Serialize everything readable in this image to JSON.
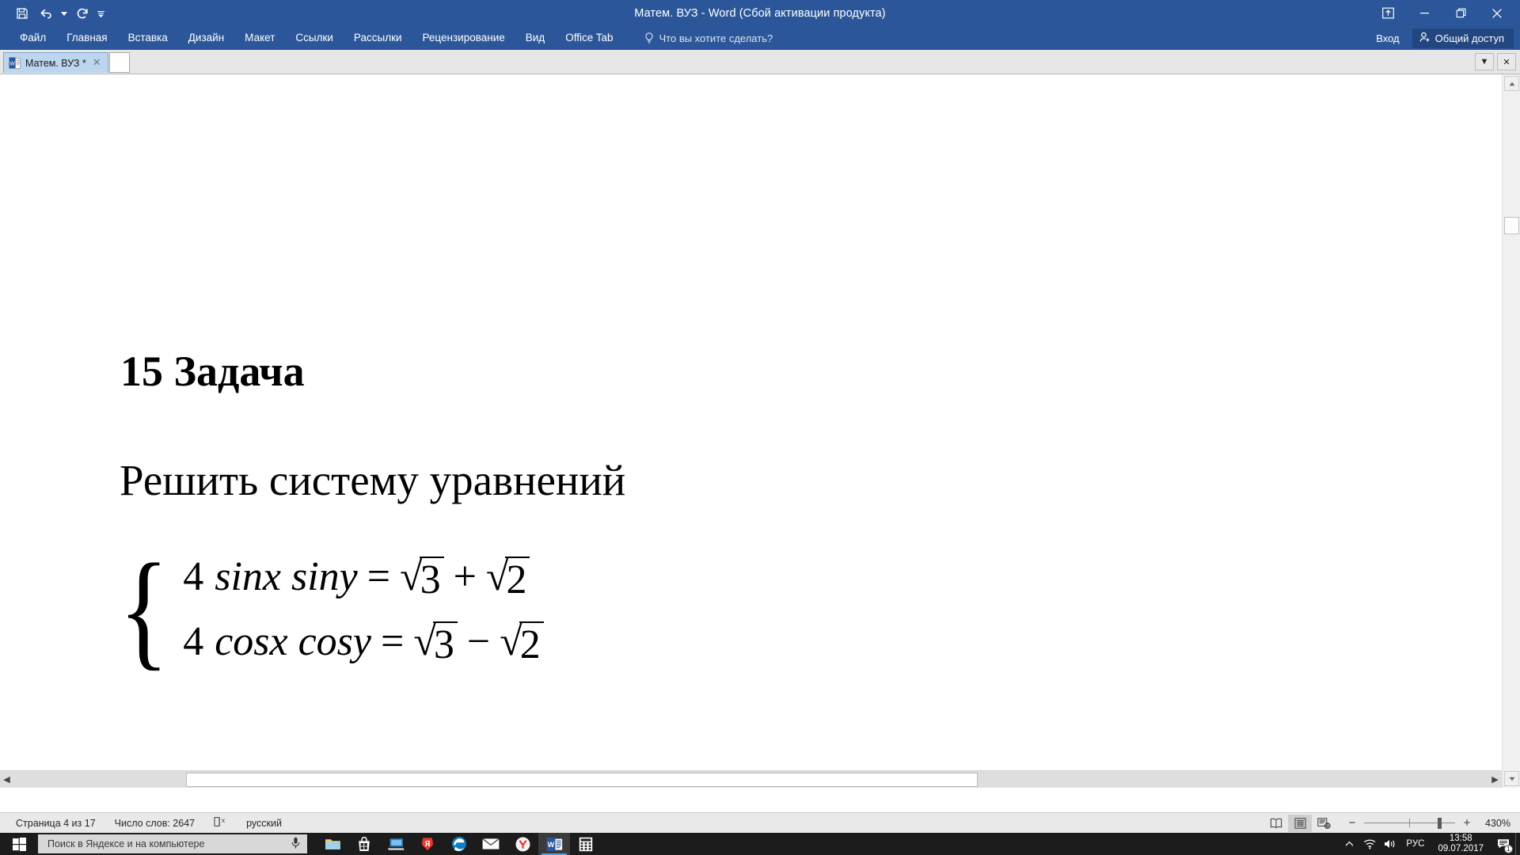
{
  "window": {
    "title": "Матем. ВУЗ - Word (Сбой активации продукта)",
    "accent_color": "#2b579a",
    "quick_access": [
      {
        "name": "save-button",
        "label": "Сохранить"
      },
      {
        "name": "undo-button",
        "label": "Отменить"
      },
      {
        "name": "redo-button",
        "label": "Вернуть"
      },
      {
        "name": "customize-qat-button",
        "label": "Настройка панели быстрого доступа"
      }
    ],
    "controls": [
      {
        "name": "ribbon-display-options-button",
        "label": "Параметры отображения ленты"
      },
      {
        "name": "minimize-button",
        "label": "Свернуть"
      },
      {
        "name": "restore-button",
        "label": "Развернуть"
      },
      {
        "name": "close-button",
        "label": "Закрыть"
      }
    ]
  },
  "ribbon": {
    "tabs": [
      {
        "label": "Файл"
      },
      {
        "label": "Главная"
      },
      {
        "label": "Вставка"
      },
      {
        "label": "Дизайн"
      },
      {
        "label": "Макет"
      },
      {
        "label": "Ссылки"
      },
      {
        "label": "Рассылки"
      },
      {
        "label": "Рецензирование"
      },
      {
        "label": "Вид"
      },
      {
        "label": "Office Tab"
      }
    ],
    "tell_me": "Что вы хотите сделать?",
    "sign_in": "Вход",
    "share": "Общий доступ"
  },
  "office_tab_bar": {
    "tabs": [
      {
        "label": "Матем. ВУЗ *",
        "active": true
      }
    ],
    "dropdown_label": "▼",
    "close_label": "✕"
  },
  "document": {
    "heading": "15 Задача",
    "paragraph": "Решить систему уравнений",
    "equations": [
      {
        "lhs_number": "4",
        "lhs_terms": "sinx siny",
        "equals": "=",
        "rhs_first_radicand": "3",
        "operator": "+",
        "rhs_second_radicand": "2",
        "plain": "4 sinx siny = √3 + √2"
      },
      {
        "lhs_number": "4",
        "lhs_terms": "cosx cosy",
        "equals": "=",
        "rhs_first_radicand": "3",
        "operator": "−",
        "rhs_second_radicand": "2",
        "plain": "4 cosx cosy = √3 − √2"
      }
    ],
    "radical_sign": "√",
    "brace": "{"
  },
  "status_bar": {
    "page": "Страница 4 из 17",
    "word_count": "Число слов: 2647",
    "proofing_icon_name": "proofing-errors-icon",
    "language": "русский",
    "views": [
      {
        "name": "read-mode-button",
        "label": "Режим чтения",
        "active": false
      },
      {
        "name": "print-layout-button",
        "label": "Разметка страницы",
        "active": true
      },
      {
        "name": "web-layout-button",
        "label": "Веб-документ",
        "active": false
      }
    ],
    "zoom_out": "−",
    "zoom_in": "+",
    "zoom_level": "430%"
  },
  "taskbar": {
    "start_label": "Пуск",
    "search_placeholder": "Поиск в Яндексе и на компьютере",
    "mic_icon_name": "microphone-icon",
    "apps": [
      {
        "name": "taskbar-file-explorer",
        "label": "Проводник",
        "active": false
      },
      {
        "name": "taskbar-store",
        "label": "Microsoft Store",
        "active": false
      },
      {
        "name": "taskbar-remote-desktop",
        "label": "Удалённый рабочий стол",
        "active": false
      },
      {
        "name": "taskbar-yandex",
        "label": "Яндекс",
        "active": false
      },
      {
        "name": "taskbar-edge",
        "label": "Microsoft Edge",
        "active": false
      },
      {
        "name": "taskbar-mail",
        "label": "Почта",
        "active": false
      },
      {
        "name": "taskbar-yandex-browser",
        "label": "Яндекс Браузер",
        "active": false
      },
      {
        "name": "taskbar-word",
        "label": "Word",
        "active": true
      },
      {
        "name": "taskbar-calculator",
        "label": "Калькулятор",
        "active": false
      }
    ],
    "tray": {
      "chevron": "⌃",
      "network_icon_name": "wifi-icon",
      "volume_icon_name": "volume-icon",
      "language": "РУС",
      "time": "13:58",
      "date": "09.07.2017",
      "notification_count": "1"
    }
  }
}
